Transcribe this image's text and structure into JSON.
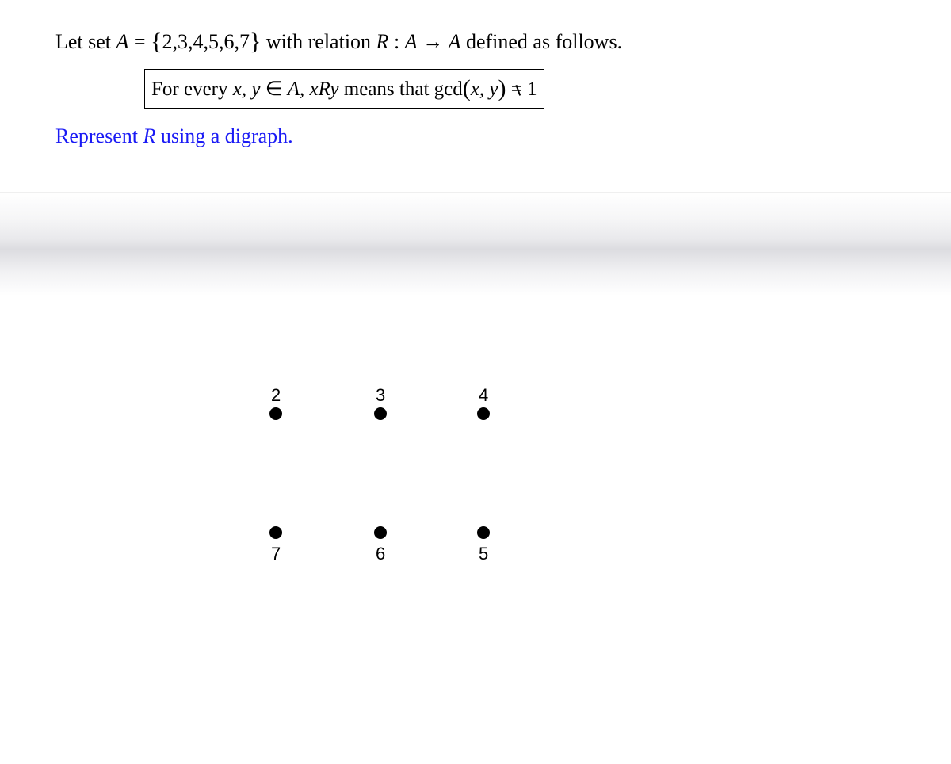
{
  "problem": {
    "line1_prefix": "Let set ",
    "set_var": "A",
    "equals": "=",
    "open_brace": "{",
    "set_members": "2,3,4,5,6,7",
    "close_brace": "}",
    "line1_mid": " with relation ",
    "relation_sym": "R",
    "colon": ": ",
    "map_from": "A",
    "arrow": " → ",
    "map_to": "A",
    "line1_suffix": " defined as follows.",
    "box_prefix": "For every ",
    "box_vars": "x, y",
    "box_elem": " ∈ ",
    "box_set": "A",
    "box_comma": ", ",
    "box_xry": "xRy",
    "box_means": " means that ",
    "box_gcd": "gcd",
    "box_open": "(",
    "box_args": "x, y",
    "box_close": ")",
    "box_eq": "=",
    "box_one": "1",
    "prompt_prefix": "Represent ",
    "prompt_R": "R",
    "prompt_suffix": " using a digraph."
  },
  "nodes": {
    "n2": "2",
    "n3": "3",
    "n4": "4",
    "n5": "5",
    "n6": "6",
    "n7": "7"
  }
}
